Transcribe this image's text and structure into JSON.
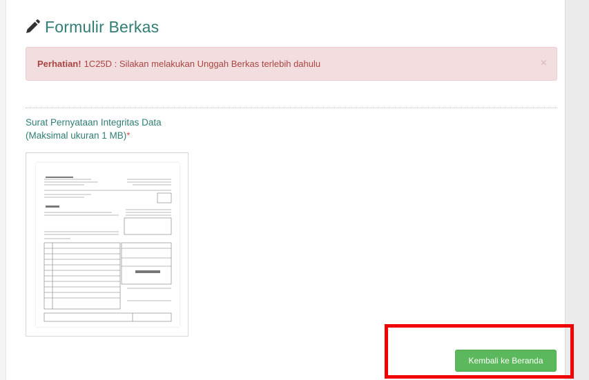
{
  "form": {
    "title": "Formulir Berkas",
    "title_icon": "pencil-icon"
  },
  "alert": {
    "strong": "Perhatian!",
    "message": "1C25D : Silakan melakukan Unggah Berkas terlebih dahulu",
    "close_label": "×"
  },
  "field": {
    "label_line1": "Surat Pernyataan Integritas Data",
    "label_line2": "(Maksimal ukuran 1 MB)",
    "required_mark": "*"
  },
  "actions": {
    "back_label": "Kembali ke Beranda"
  },
  "colors": {
    "accent": "#2f7d74",
    "alert_bg": "#f2dede",
    "alert_text": "#a94442",
    "button": "#5cb85c",
    "highlight": "#f00000"
  }
}
